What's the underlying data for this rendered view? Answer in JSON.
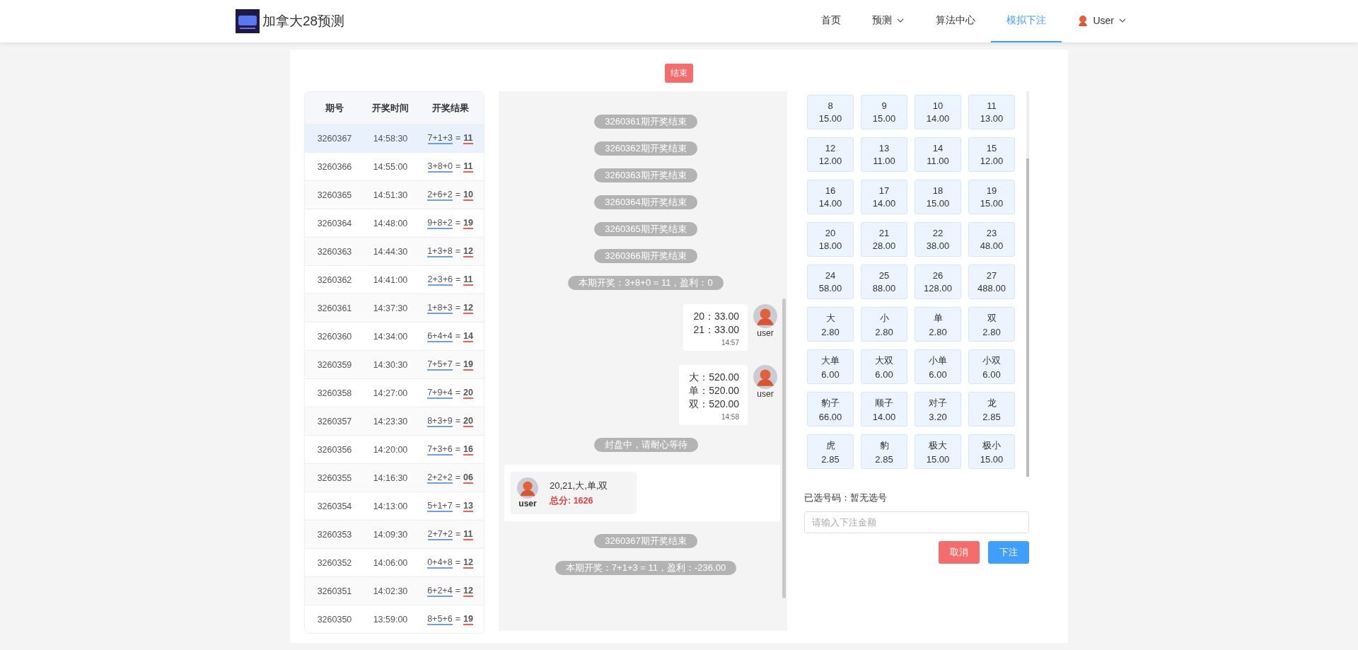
{
  "brand": {
    "title": "加拿大28预测"
  },
  "nav": [
    {
      "label": "首页",
      "kind": "link",
      "selected": false
    },
    {
      "label": "预测",
      "kind": "dropdown",
      "selected": false
    },
    {
      "label": "算法中心",
      "kind": "link",
      "selected": false
    },
    {
      "label": "模拟下注",
      "kind": "link",
      "selected": true
    },
    {
      "label": "User",
      "kind": "user",
      "selected": false
    }
  ],
  "end_button": "结束",
  "history": {
    "columns": [
      "期号",
      "开奖时间",
      "开奖结果"
    ],
    "rows": [
      {
        "issue": "3260367",
        "time": "14:58:30",
        "sum": "7+1+3",
        "eq": "=",
        "total": "11",
        "selected": true
      },
      {
        "issue": "3260366",
        "time": "14:55:00",
        "sum": "3+8+0",
        "eq": "=",
        "total": "11",
        "selected": false
      },
      {
        "issue": "3260365",
        "time": "14:51:30",
        "sum": "2+6+2",
        "eq": "=",
        "total": "10",
        "selected": false
      },
      {
        "issue": "3260364",
        "time": "14:48:00",
        "sum": "9+8+2",
        "eq": "=",
        "total": "19",
        "selected": false
      },
      {
        "issue": "3260363",
        "time": "14:44:30",
        "sum": "1+3+8",
        "eq": "=",
        "total": "12",
        "selected": false
      },
      {
        "issue": "3260362",
        "time": "14:41:00",
        "sum": "2+3+6",
        "eq": "=",
        "total": "11",
        "selected": false
      },
      {
        "issue": "3260361",
        "time": "14:37:30",
        "sum": "1+8+3",
        "eq": "=",
        "total": "12",
        "selected": false
      },
      {
        "issue": "3260360",
        "time": "14:34:00",
        "sum": "6+4+4",
        "eq": "=",
        "total": "14",
        "selected": false
      },
      {
        "issue": "3260359",
        "time": "14:30:30",
        "sum": "7+5+7",
        "eq": "=",
        "total": "19",
        "selected": false
      },
      {
        "issue": "3260358",
        "time": "14:27:00",
        "sum": "7+9+4",
        "eq": "=",
        "total": "20",
        "selected": false
      },
      {
        "issue": "3260357",
        "time": "14:23:30",
        "sum": "8+3+9",
        "eq": "=",
        "total": "20",
        "selected": false
      },
      {
        "issue": "3260356",
        "time": "14:20:00",
        "sum": "7+3+6",
        "eq": "=",
        "total": "16",
        "selected": false
      },
      {
        "issue": "3260355",
        "time": "14:16:30",
        "sum": "2+2+2",
        "eq": "=",
        "total": "06",
        "selected": false
      },
      {
        "issue": "3260354",
        "time": "14:13:00",
        "sum": "5+1+7",
        "eq": "=",
        "total": "13",
        "selected": false
      },
      {
        "issue": "3260353",
        "time": "14:09:30",
        "sum": "2+7+2",
        "eq": "=",
        "total": "11",
        "selected": false
      },
      {
        "issue": "3260352",
        "time": "14:06:00",
        "sum": "0+4+8",
        "eq": "=",
        "total": "12",
        "selected": false
      },
      {
        "issue": "3260351",
        "time": "14:02:30",
        "sum": "6+2+4",
        "eq": "=",
        "total": "12",
        "selected": false
      },
      {
        "issue": "3260350",
        "time": "13:59:00",
        "sum": "8+5+6",
        "eq": "=",
        "total": "19",
        "selected": false
      }
    ]
  },
  "chat": [
    {
      "kind": "notice",
      "text": "3260361期开奖结束"
    },
    {
      "kind": "notice",
      "text": "3260362期开奖结束"
    },
    {
      "kind": "notice",
      "text": "3260363期开奖结束"
    },
    {
      "kind": "notice",
      "text": "3260364期开奖结束"
    },
    {
      "kind": "notice",
      "text": "3260365期开奖结束"
    },
    {
      "kind": "notice",
      "text": "3260366期开奖结束"
    },
    {
      "kind": "notice",
      "text": "本期开奖：3+8+0 = 11，盈利：0"
    },
    {
      "kind": "bet",
      "lines": [
        "20：33.00",
        "21：33.00"
      ],
      "time": "14:57",
      "user": "user"
    },
    {
      "kind": "bet",
      "lines": [
        "大：520.00",
        "单：520.00",
        "双：520.00"
      ],
      "time": "14:58",
      "user": "user"
    },
    {
      "kind": "notice",
      "text": "封盘中，请耐心等待"
    },
    {
      "kind": "summary",
      "user": "user",
      "picks": "20,21,大,单,双",
      "score": "总分: 1626"
    },
    {
      "kind": "notice",
      "text": "3260367期开奖结束"
    },
    {
      "kind": "notice",
      "text": "本期开奖：7+1+3 = 11，盈利：-236.00"
    }
  ],
  "odds": [
    {
      "label": "8",
      "odds": "15.00",
      "selected": false
    },
    {
      "label": "9",
      "odds": "15.00",
      "selected": false
    },
    {
      "label": "10",
      "odds": "14.00",
      "selected": false
    },
    {
      "label": "11",
      "odds": "13.00",
      "selected": false
    },
    {
      "label": "12",
      "odds": "12.00",
      "selected": false
    },
    {
      "label": "13",
      "odds": "11.00",
      "selected": false
    },
    {
      "label": "14",
      "odds": "11.00",
      "selected": false
    },
    {
      "label": "15",
      "odds": "12.00",
      "selected": false
    },
    {
      "label": "16",
      "odds": "14.00",
      "selected": false
    },
    {
      "label": "17",
      "odds": "14.00",
      "selected": false
    },
    {
      "label": "18",
      "odds": "15.00",
      "selected": false
    },
    {
      "label": "19",
      "odds": "15.00",
      "selected": false
    },
    {
      "label": "20",
      "odds": "18.00",
      "selected": false
    },
    {
      "label": "21",
      "odds": "28.00",
      "selected": false
    },
    {
      "label": "22",
      "odds": "38.00",
      "selected": false
    },
    {
      "label": "23",
      "odds": "48.00",
      "selected": false
    },
    {
      "label": "24",
      "odds": "58.00",
      "selected": false
    },
    {
      "label": "25",
      "odds": "88.00",
      "selected": false
    },
    {
      "label": "26",
      "odds": "128.00",
      "selected": false
    },
    {
      "label": "27",
      "odds": "488.00",
      "selected": false
    },
    {
      "label": "大",
      "odds": "2.80",
      "selected": false
    },
    {
      "label": "小",
      "odds": "2.80",
      "selected": false
    },
    {
      "label": "单",
      "odds": "2.80",
      "selected": false
    },
    {
      "label": "双",
      "odds": "2.80",
      "selected": false
    },
    {
      "label": "大单",
      "odds": "6.00",
      "selected": false
    },
    {
      "label": "大双",
      "odds": "6.00",
      "selected": false
    },
    {
      "label": "小单",
      "odds": "6.00",
      "selected": false
    },
    {
      "label": "小双",
      "odds": "6.00",
      "selected": false
    },
    {
      "label": "豹子",
      "odds": "66.00",
      "selected": false
    },
    {
      "label": "顺子",
      "odds": "14.00",
      "selected": false
    },
    {
      "label": "对子",
      "odds": "3.20",
      "selected": false
    },
    {
      "label": "龙",
      "odds": "2.85",
      "selected": false
    },
    {
      "label": "虎",
      "odds": "2.85",
      "selected": false
    },
    {
      "label": "豹",
      "odds": "2.85",
      "selected": false
    },
    {
      "label": "极大",
      "odds": "15.00",
      "selected": false
    },
    {
      "label": "极小",
      "odds": "15.00",
      "selected": false
    }
  ],
  "selection": {
    "label": "已选号码：",
    "value": "暂无选号"
  },
  "amount": {
    "placeholder": "请输入下注金额"
  },
  "actions": [
    {
      "label": "取消",
      "kind": "cancel"
    },
    {
      "label": "下注",
      "kind": "submit"
    }
  ]
}
